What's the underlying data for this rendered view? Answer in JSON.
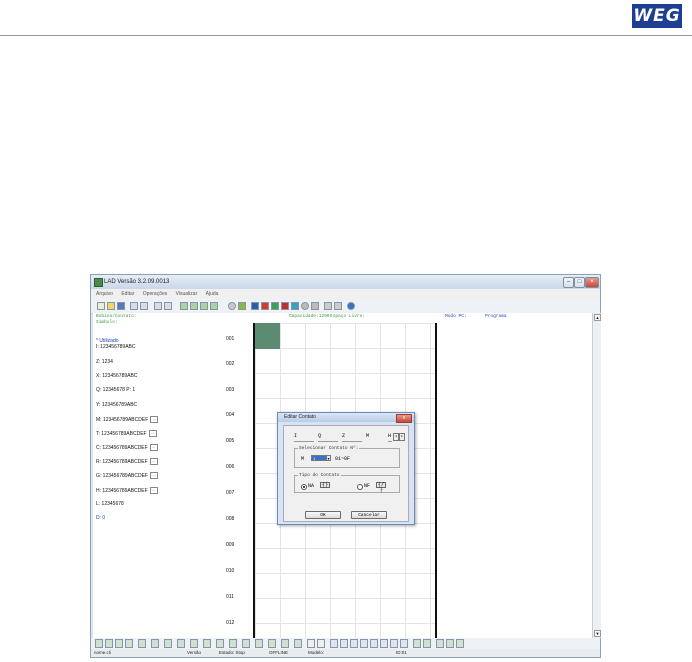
{
  "header": {
    "logo_text": "WEG",
    "brand_color": "#1c3f93"
  },
  "window": {
    "title": "LAD Versão 3.2.09.0013",
    "menu": [
      "Arquivo",
      "Editar",
      "Operações",
      "Visualizar",
      "Ajuda"
    ],
    "info": {
      "bobina_label": "Bobina/Contato:",
      "simbolo_label": "Símbolo:",
      "capacidade": "Capacidade:1200",
      "espaco": "Espaço Livre:",
      "modo_label": "Modo PC:",
      "modo_value": "Programa"
    },
    "left_pane": {
      "section_title": "* Utilizado",
      "items": [
        "I: 123456789ABC",
        "Z: 1234",
        "X: 123456789ABC",
        "Q: 12345678  P: 1",
        "Y: 123456789ABC",
        "M: 123456789ABCDEF",
        "T: 123456789ABCDEF",
        "C: 123456789ABCDEF",
        "R: 123456789ABCDEF",
        "G: 123456789ABCDEF",
        "H: 123456789ABCDEF",
        "L: 12345678",
        "D:  0"
      ],
      "more_btn": "..."
    },
    "line_numbers": [
      "001",
      "002",
      "003",
      "004",
      "005",
      "006",
      "007",
      "008",
      "009",
      "010",
      "011",
      "012"
    ],
    "status": {
      "file": "nome.cli",
      "version": "Versão",
      "state": "Estado: Stop",
      "online": "OFFLINE",
      "model": "Modelo:",
      "id": "ID:01"
    },
    "colors": {
      "cursor": "#5b8c72",
      "info_text": "#3a9a3a",
      "pane_accent": "#1f3fbf"
    }
  },
  "dialog": {
    "title": "Editar Contato",
    "close_label": "x",
    "tabs": [
      "I",
      "Q",
      "Z",
      "M",
      "H"
    ],
    "select_group_label": "Selecionar Contato Nº:",
    "selected_prefix": "M",
    "selected_value": "1",
    "range_text": "01~0F",
    "type_group_label": "Tipo do Contato",
    "option_na": "NA",
    "option_nf": "NF",
    "ok_label": "OK",
    "cancel_label": "Cancelar"
  }
}
